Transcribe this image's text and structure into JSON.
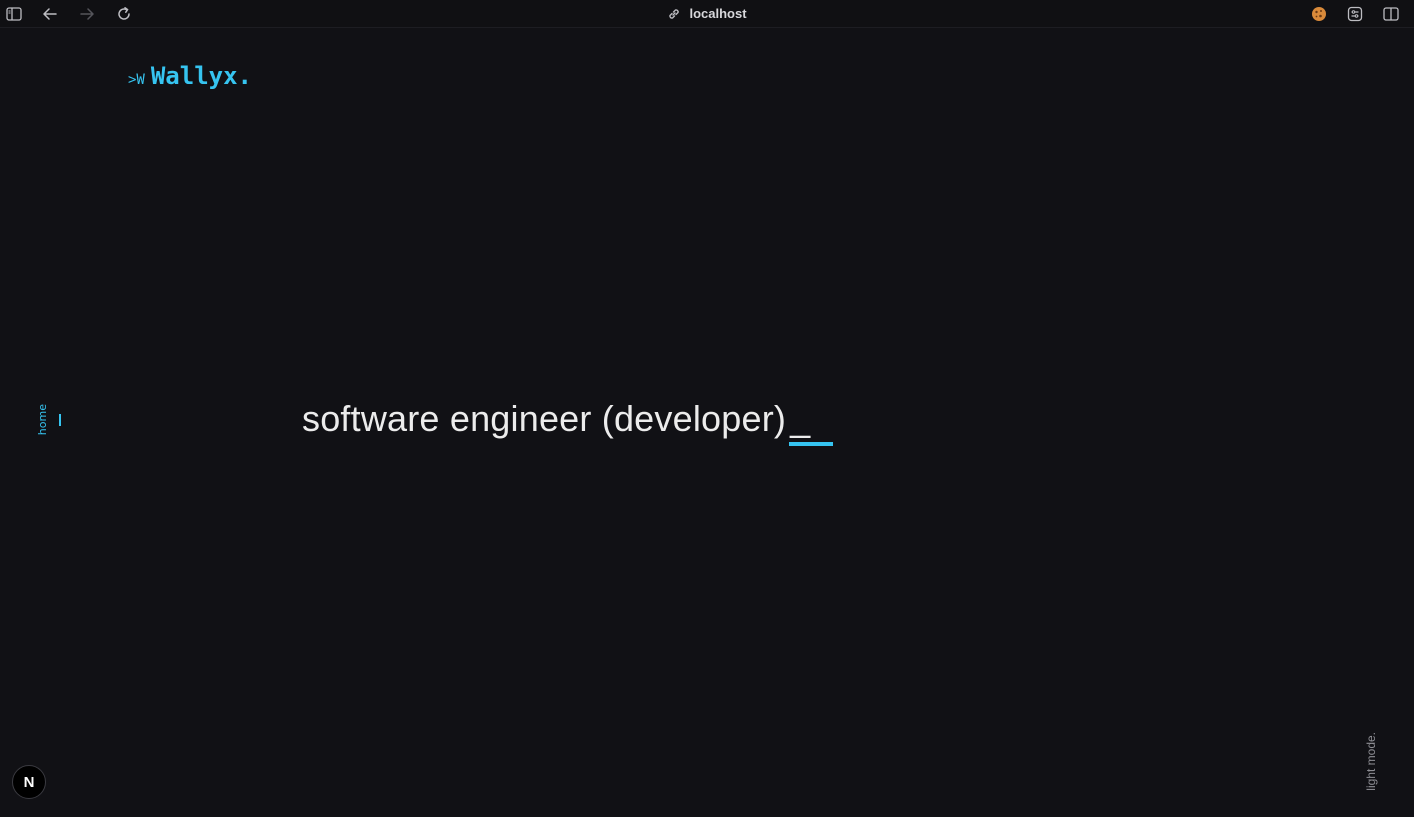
{
  "browser": {
    "address": "localhost",
    "icons": {
      "sidebar": "sidebar-toggle-icon",
      "back": "back-arrow-icon",
      "forward": "forward-arrow-icon",
      "reload": "reload-icon",
      "link": "link-icon",
      "cookie": "cookie-extension-icon",
      "extension": "extension-icon",
      "split": "split-view-icon"
    }
  },
  "header": {
    "logo_mark": ">W",
    "logo_text": "Wallyx."
  },
  "side_nav": {
    "active_label": "home"
  },
  "hero": {
    "text": "software engineer (developer)",
    "cursor": "_"
  },
  "theme_toggle": {
    "label": "light mode."
  },
  "dev_badge": {
    "label": "N"
  },
  "colors": {
    "background": "#111115",
    "accent": "#36c4f0",
    "text": "#ececec",
    "muted": "#8e8e94"
  }
}
